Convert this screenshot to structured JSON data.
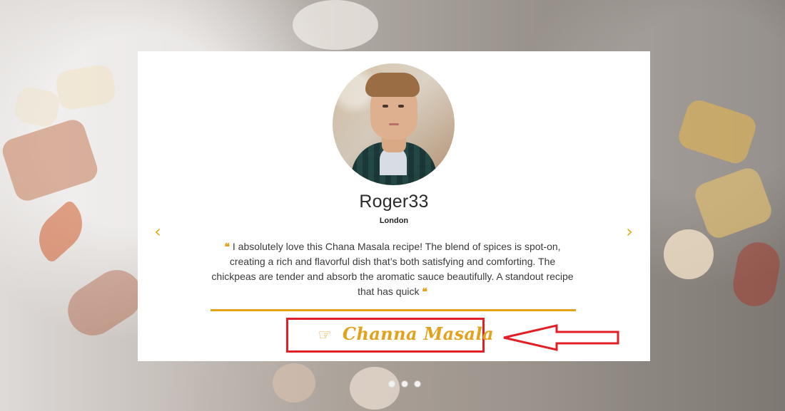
{
  "testimonial": {
    "name": "Roger33",
    "location": "London",
    "quote_open": "❝",
    "quote_close": "❝",
    "text": "I absolutely love this Chana Masala recipe! The blend of spices is spot-on, creating a rich and flavorful dish that’s both satisfying and comforting. The chickpeas are tender and absorb the aromatic sauce beautifully. A standout recipe that has quick"
  },
  "carousel": {
    "prev_glyph": "‹",
    "next_glyph": "›",
    "dots": 3
  },
  "recipe": {
    "icon": "hand-pointing-icon",
    "icon_glyph": "☞",
    "label": "Channa Masala"
  },
  "colors": {
    "accent": "#e3a11c",
    "annotation": "#e01f26",
    "card": "#ffffff"
  }
}
